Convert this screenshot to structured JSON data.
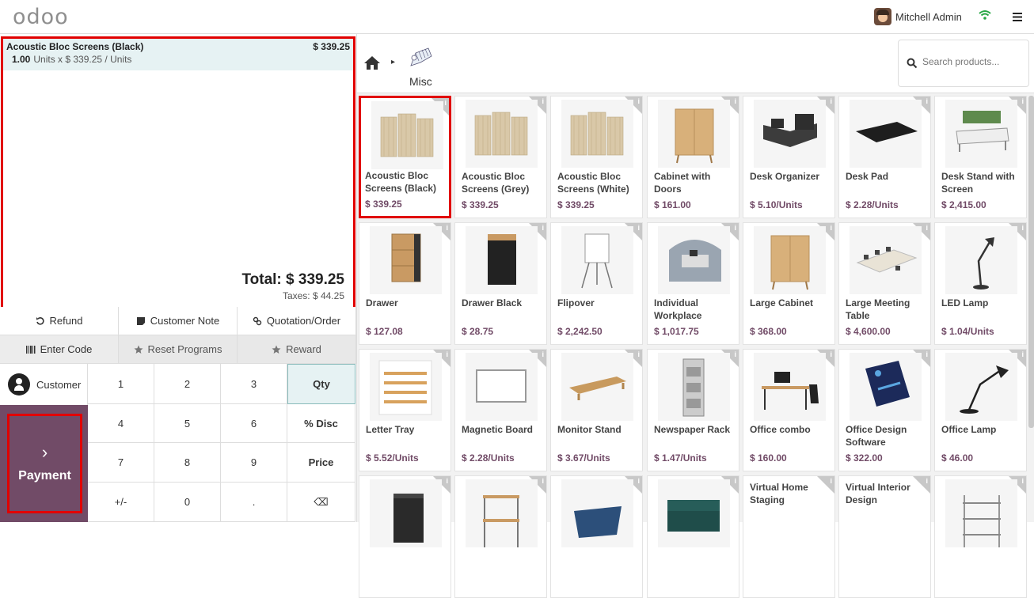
{
  "app": {
    "logo": "odoo",
    "user_name": "Mitchell Admin",
    "wifi_icon": "wifi-icon",
    "menu_icon": "hamburger-icon"
  },
  "order": {
    "line": {
      "name": "Acoustic Bloc Screens (Black)",
      "price": "$ 339.25",
      "qty": "1.00",
      "detail": "Units x $ 339.25 / Units"
    },
    "total": "Total: $ 339.25",
    "taxes": "Taxes: $ 44.25"
  },
  "controls": {
    "refund": "Refund",
    "customer_note": "Customer Note",
    "quotation": "Quotation/Order",
    "enter_code": "Enter Code",
    "reset_programs": "Reset Programs",
    "reward": "Reward"
  },
  "customer_label": "Customer",
  "payment_label": "Payment",
  "numpad": {
    "keys": [
      "1",
      "2",
      "3",
      "Qty",
      "4",
      "5",
      "6",
      "% Disc",
      "7",
      "8",
      "9",
      "Price",
      "+/-",
      "0",
      ".",
      "⌫"
    ],
    "active_mode": "Qty"
  },
  "breadcrumb": {
    "category": "Misc"
  },
  "search": {
    "placeholder": "Search products..."
  },
  "products": [
    {
      "name": "Acoustic Bloc Screens (Black)",
      "price": "$ 339.25"
    },
    {
      "name": "Acoustic Bloc Screens (Grey)",
      "price": "$ 339.25"
    },
    {
      "name": "Acoustic Bloc Screens (White)",
      "price": "$ 339.25"
    },
    {
      "name": "Cabinet with Doors",
      "price": "$ 161.00"
    },
    {
      "name": "Desk Organizer",
      "price": "$ 5.10/Units"
    },
    {
      "name": "Desk Pad",
      "price": "$ 2.28/Units"
    },
    {
      "name": "Desk Stand with Screen",
      "price": "$ 2,415.00"
    },
    {
      "name": "Drawer",
      "price": "$ 127.08"
    },
    {
      "name": "Drawer Black",
      "price": "$ 28.75"
    },
    {
      "name": "Flipover",
      "price": "$ 2,242.50"
    },
    {
      "name": "Individual Workplace",
      "price": "$ 1,017.75"
    },
    {
      "name": "Large Cabinet",
      "price": "$ 368.00"
    },
    {
      "name": "Large Meeting Table",
      "price": "$ 4,600.00"
    },
    {
      "name": "LED Lamp",
      "price": "$ 1.04/Units"
    },
    {
      "name": "Letter Tray",
      "price": "$ 5.52/Units"
    },
    {
      "name": "Magnetic Board",
      "price": "$ 2.28/Units"
    },
    {
      "name": "Monitor Stand",
      "price": "$ 3.67/Units"
    },
    {
      "name": "Newspaper Rack",
      "price": "$ 1.47/Units"
    },
    {
      "name": "Office combo",
      "price": "$ 160.00"
    },
    {
      "name": "Office Design Software",
      "price": "$ 322.00"
    },
    {
      "name": "Office Lamp",
      "price": "$ 46.00"
    },
    {
      "name": "",
      "price": ""
    },
    {
      "name": "",
      "price": ""
    },
    {
      "name": "",
      "price": ""
    },
    {
      "name": "",
      "price": ""
    },
    {
      "name": "Virtual Home Staging",
      "price": ""
    },
    {
      "name": "Virtual Interior Design",
      "price": ""
    },
    {
      "name": "",
      "price": ""
    }
  ]
}
